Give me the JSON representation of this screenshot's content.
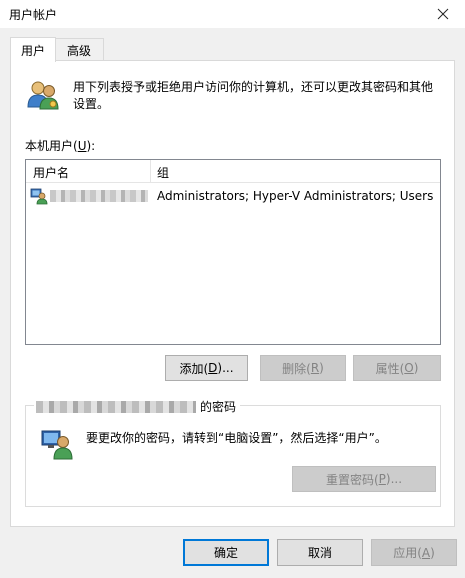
{
  "window": {
    "title": "用户帐户",
    "close_glyph": "✕"
  },
  "tabs": [
    {
      "label": "用户",
      "active": true
    },
    {
      "label": "高级",
      "active": false
    }
  ],
  "info": {
    "text": "用下列表授予或拒绝用户访问你的计算机，还可以更改其密码和其他设置。"
  },
  "local_users": {
    "label_prefix": "本机用户(",
    "label_key": "U",
    "label_suffix": "):",
    "columns": {
      "name": "用户名",
      "group": "组"
    },
    "rows": [
      {
        "group": "Administrators; Hyper-V Administrators; Users"
      }
    ]
  },
  "buttons": {
    "add": {
      "prefix": "添加(",
      "key": "D",
      "suffix": ")..."
    },
    "remove": {
      "prefix": "删除(",
      "key": "R",
      "suffix": ")"
    },
    "properties": {
      "prefix": "属性(",
      "key": "O",
      "suffix": ")"
    }
  },
  "password_group": {
    "title_suffix": "的密码",
    "text": "要更改你的密码，请转到“电脑设置”，然后选择“用户”。",
    "reset": {
      "prefix": "重置密码(",
      "key": "P",
      "suffix": ")..."
    }
  },
  "footer": {
    "ok": "确定",
    "cancel": "取消",
    "apply": {
      "prefix": "应用(",
      "key": "A",
      "suffix": ")"
    }
  },
  "colors": {
    "focus_border": "#0078d7",
    "disabled_text": "#838383",
    "panel_bg": "#ffffff",
    "window_bg": "#f0f0f0"
  },
  "icons": {
    "users_icon": "users-icon",
    "user_row_icon": "user-icon",
    "password_icon": "user-computer-icon",
    "close_icon": "close-icon"
  }
}
